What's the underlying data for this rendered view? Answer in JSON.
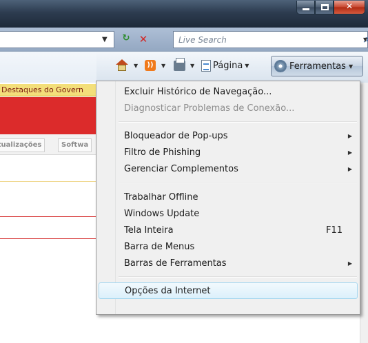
{
  "window": {
    "caption_buttons": [
      "minimize",
      "maximize",
      "close"
    ]
  },
  "address_bar": {
    "refresh_icon": "refresh-arrows-icon",
    "stop_icon": "stop-x-icon"
  },
  "search": {
    "placeholder": "Live Search"
  },
  "command_bar": {
    "page_label": "Página",
    "tools_label": "Ferramentas"
  },
  "page": {
    "gov_bar_text": "Destaques do Govern",
    "tab_1": "Atualizações",
    "tab_2": "Softwa"
  },
  "menu": {
    "items": [
      {
        "label": "Excluir Histórico de Navegação...",
        "enabled": true
      },
      {
        "label": "Diagnosticar Problemas de Conexão...",
        "enabled": false
      },
      {
        "label": "Bloqueador de Pop-ups",
        "submenu": true
      },
      {
        "label": "Filtro de Phishing",
        "submenu": true
      },
      {
        "label": "Gerenciar Complementos",
        "submenu": true
      },
      {
        "label": "Trabalhar Offline"
      },
      {
        "label": "Windows Update"
      },
      {
        "label": "Tela Inteira",
        "shortcut": "F11"
      },
      {
        "label": "Barra de Menus"
      },
      {
        "label": "Barras de Ferramentas",
        "submenu": true
      },
      {
        "label": "Opções da Internet",
        "highlighted": true
      }
    ]
  },
  "colors": {
    "menu_highlight": "#dcf0fb",
    "page_red": "#dc2b2b",
    "gov_bar": "#f3df7a"
  }
}
